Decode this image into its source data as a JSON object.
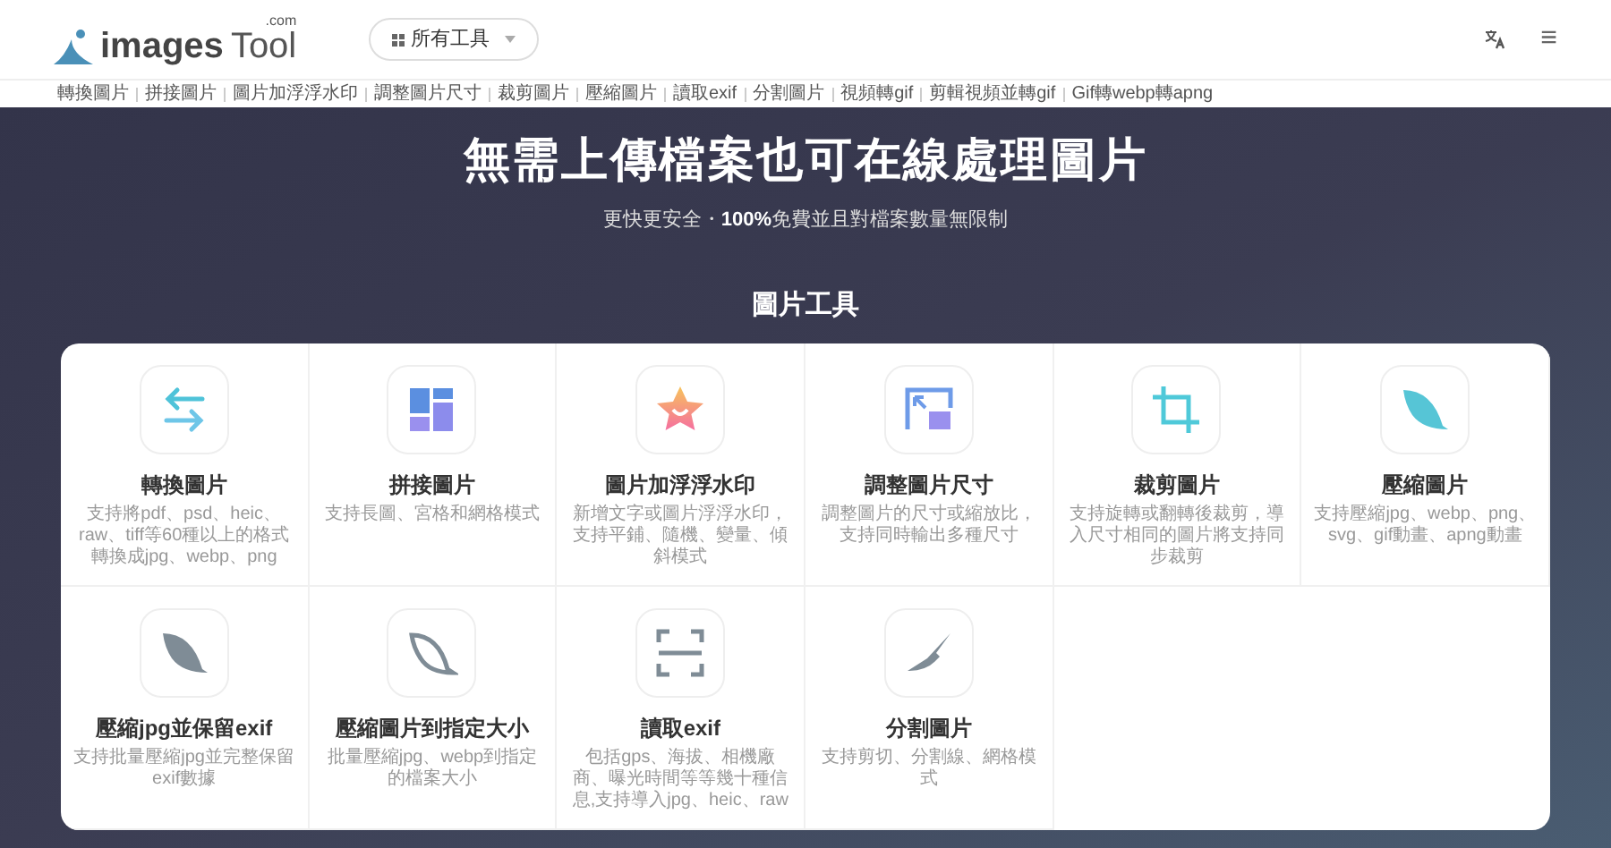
{
  "header": {
    "logo_text": "images",
    "logo_text_2": "Tool",
    "logo_sup": ".com",
    "tools_button": "所有工具",
    "menu_button_icon": "≡"
  },
  "nav_links": [
    "轉換圖片",
    "拼接圖片",
    "圖片加浮浮水印",
    "調整圖片尺寸",
    "裁剪圖片",
    "壓縮圖片",
    "讀取exif",
    "分割圖片",
    "視頻轉gif",
    "剪輯視頻並轉gif",
    "Gif轉webp轉apng"
  ],
  "hero": {
    "title": "無需上傳檔案也可在線處理圖片",
    "subtitle_pre": "更快更安全・",
    "subtitle_bold": "100%",
    "subtitle_post": "免費並且對檔案數量無限制"
  },
  "section_title": "圖片工具",
  "tools": [
    {
      "kind": "convert",
      "title": "轉換圖片",
      "description": "支持將pdf、psd、heic、raw、tiff等60種以上的格式轉換成jpg、webp、png"
    },
    {
      "kind": "collage",
      "title": "拼接圖片",
      "description": "支持長圖、宮格和網格模式"
    },
    {
      "kind": "watermark",
      "title": "圖片加浮浮水印",
      "description": "新增文字或圖片浮浮水印，支持平鋪、隨機、變量、傾斜模式"
    },
    {
      "kind": "resize",
      "title": "調整圖片尺寸",
      "description": "調整圖片的尺寸或縮放比，支持同時輸出多種尺寸"
    },
    {
      "kind": "crop",
      "title": "裁剪圖片",
      "description": "支持旋轉或翻轉後裁剪，導入尺寸相同的圖片將支持同步裁剪"
    },
    {
      "kind": "compress",
      "title": "壓縮圖片",
      "description": "支持壓縮jpg、webp、png、svg、gif動畫、apng動畫"
    },
    {
      "kind": "compress_exif",
      "title": "壓縮jpg並保留exif",
      "description": "支持批量壓縮jpg並完整保留exif數據"
    },
    {
      "kind": "compress_size",
      "title": "壓縮圖片到指定大小",
      "description": "批量壓縮jpg、webp到指定的檔案大小"
    },
    {
      "kind": "exif",
      "title": "讀取exif",
      "description": "包括gps、海拔、相機廠商、曝光時間等等幾十種信息,支持導入jpg、heic、raw"
    },
    {
      "kind": "split",
      "title": "分割圖片",
      "description": "支持剪切、分割線、網格模式"
    }
  ]
}
